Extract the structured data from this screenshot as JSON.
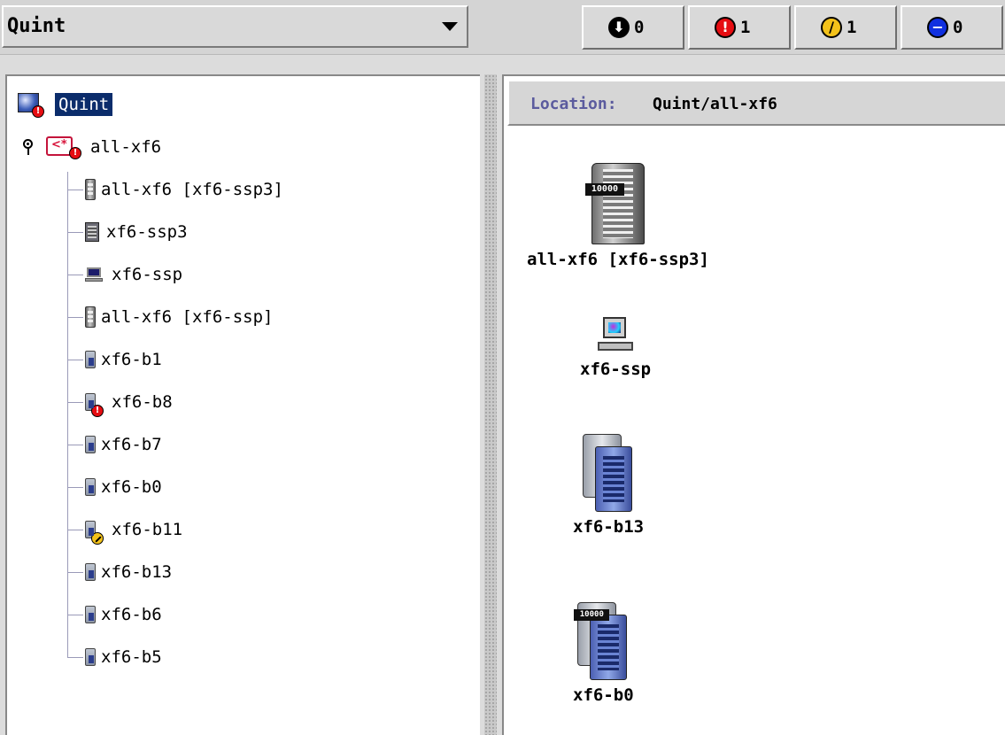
{
  "toolbar": {
    "domain_selector": {
      "value": "Quint"
    },
    "alarms": [
      {
        "name": "down",
        "glyph": "⬇",
        "count": "0",
        "color": "#000000"
      },
      {
        "name": "critical",
        "glyph": "!",
        "count": "1",
        "color": "#e60d12"
      },
      {
        "name": "major",
        "glyph": "/",
        "count": "1",
        "color": "#f3c21a"
      },
      {
        "name": "minor",
        "glyph": "−",
        "count": "0",
        "color": "#1030e0"
      }
    ]
  },
  "location": {
    "label": "Location:",
    "value": "Quint/all-xf6"
  },
  "tree": {
    "root": {
      "label": "Quint",
      "icon": "globe-icon",
      "status": "critical"
    },
    "group": {
      "label": "all-xf6",
      "icon": "domain-icon",
      "status": "critical",
      "expanded": true
    },
    "children": [
      {
        "label": "all-xf6 [xf6-ssp3]",
        "icon": "rack-icon",
        "status": ""
      },
      {
        "label": "xf6-ssp3",
        "icon": "chassis-icon",
        "status": ""
      },
      {
        "label": "xf6-ssp",
        "icon": "workstation-icon",
        "status": ""
      },
      {
        "label": "all-xf6 [xf6-ssp]",
        "icon": "rack-icon",
        "status": ""
      },
      {
        "label": "xf6-b1",
        "icon": "board-icon",
        "status": ""
      },
      {
        "label": "xf6-b8",
        "icon": "board-icon",
        "status": "critical"
      },
      {
        "label": "xf6-b7",
        "icon": "board-icon",
        "status": ""
      },
      {
        "label": "xf6-b0",
        "icon": "board-icon",
        "status": ""
      },
      {
        "label": "xf6-b11",
        "icon": "board-icon",
        "status": "major"
      },
      {
        "label": "xf6-b13",
        "icon": "board-icon",
        "status": ""
      },
      {
        "label": "xf6-b6",
        "icon": "board-icon",
        "status": ""
      },
      {
        "label": "xf6-b5",
        "icon": "board-icon",
        "status": ""
      }
    ]
  },
  "content": {
    "items": [
      {
        "label": "all-xf6 [xf6-ssp3]",
        "icon": "rack-icon",
        "badge": "10000"
      },
      {
        "label": "xf6-ssp",
        "icon": "workstation-icon"
      },
      {
        "label": "xf6-b13",
        "icon": "board-icon"
      },
      {
        "label": "xf6-b0",
        "icon": "board-icon",
        "badge": "10000"
      }
    ]
  }
}
